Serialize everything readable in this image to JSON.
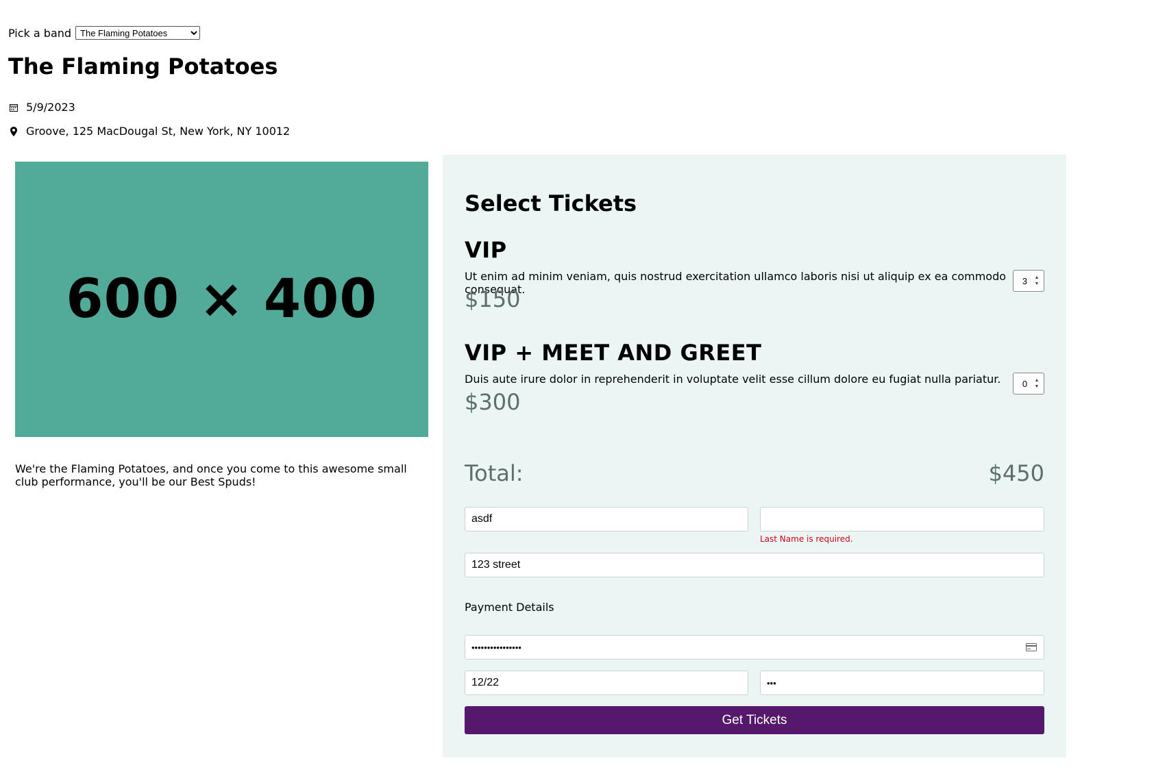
{
  "band_picker": {
    "label": "Pick a band",
    "selected": "The Flaming Potatoes"
  },
  "band": {
    "name": "The Flaming Potatoes",
    "date": "5/9/2023",
    "location": "Groove, 125 MacDougal St, New York, NY 10012",
    "image_text": "600 × 400",
    "description": "We're the Flaming Potatoes, and once you come to this awesome small club performance, you'll be our Best Spuds!"
  },
  "tickets": {
    "heading": "Select Tickets",
    "items": [
      {
        "name": "VIP",
        "description": "Ut enim ad minim veniam, quis nostrud exercitation ullamco laboris nisi ut aliquip ex ea commodo consequat.",
        "price": "$150",
        "quantity": "3"
      },
      {
        "name": "VIP + MEET AND GREET",
        "description": "Duis aute irure dolor in reprehenderit in voluptate velit esse cillum dolore eu fugiat nulla pariatur.",
        "price": "$300",
        "quantity": "0"
      }
    ],
    "total_label": "Total:",
    "total_value": "$450"
  },
  "form": {
    "first_name": "asdf",
    "last_name": "",
    "last_name_error": "Last Name is required.",
    "address": "123 street",
    "payment_label": "Payment Details",
    "card_number": "••••••••••••••••",
    "expiry": "12/22",
    "cvv": "•••",
    "submit_label": "Get Tickets"
  },
  "icons": {
    "date": "calendar-icon",
    "location": "map-pin-icon",
    "card": "credit-card-icon"
  },
  "colors": {
    "hero": "#52ab98",
    "panel": "#ebf5f3",
    "button": "#55186a",
    "error": "#d0021b"
  }
}
